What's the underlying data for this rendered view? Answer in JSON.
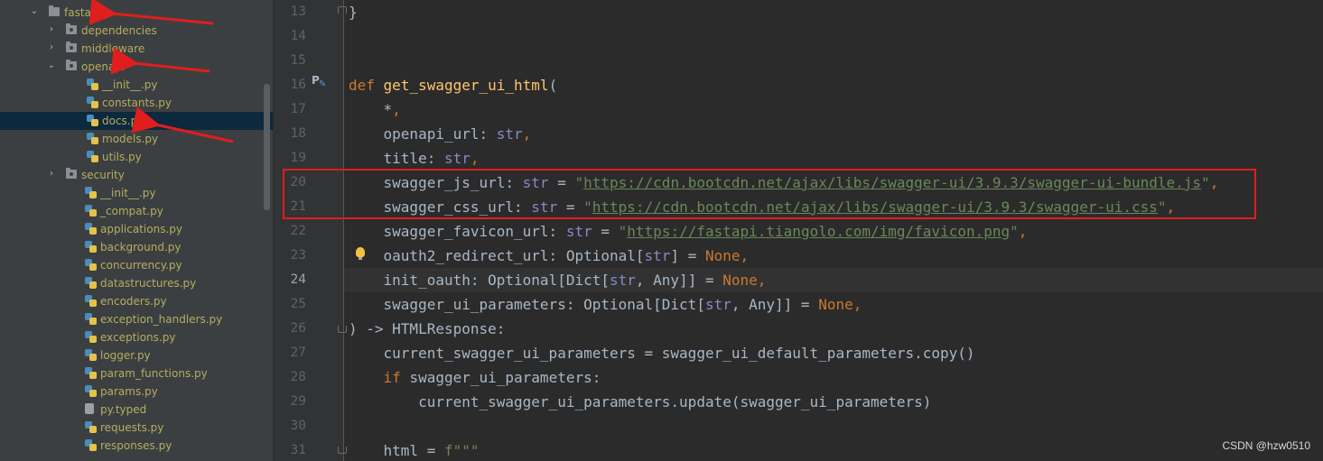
{
  "project_tree": {
    "items": [
      {
        "label": "fastapi",
        "kind": "folder",
        "depth": 0,
        "arrow": "open",
        "selected": false
      },
      {
        "label": "dependencies",
        "kind": "package",
        "depth": 1,
        "arrow": "closed",
        "selected": false
      },
      {
        "label": "middleware",
        "kind": "package",
        "depth": 1,
        "arrow": "closed",
        "selected": false
      },
      {
        "label": "openapi",
        "kind": "package",
        "depth": 1,
        "arrow": "open",
        "selected": false
      },
      {
        "label": "__init__.py",
        "kind": "py",
        "depth": 2,
        "arrow": "none",
        "selected": false
      },
      {
        "label": "constants.py",
        "kind": "py",
        "depth": 2,
        "arrow": "none",
        "selected": false
      },
      {
        "label": "docs.py",
        "kind": "py",
        "depth": 2,
        "arrow": "none",
        "selected": true
      },
      {
        "label": "models.py",
        "kind": "py",
        "depth": 2,
        "arrow": "none",
        "selected": false
      },
      {
        "label": "utils.py",
        "kind": "py",
        "depth": 2,
        "arrow": "none",
        "selected": false
      },
      {
        "label": "security",
        "kind": "package",
        "depth": 1,
        "arrow": "closed",
        "selected": false
      },
      {
        "label": "__init__.py",
        "kind": "py",
        "depth": 1,
        "arrow": "none",
        "selected": false
      },
      {
        "label": "_compat.py",
        "kind": "py",
        "depth": 1,
        "arrow": "none",
        "selected": false
      },
      {
        "label": "applications.py",
        "kind": "py",
        "depth": 1,
        "arrow": "none",
        "selected": false
      },
      {
        "label": "background.py",
        "kind": "py",
        "depth": 1,
        "arrow": "none",
        "selected": false
      },
      {
        "label": "concurrency.py",
        "kind": "py",
        "depth": 1,
        "arrow": "none",
        "selected": false
      },
      {
        "label": "datastructures.py",
        "kind": "py",
        "depth": 1,
        "arrow": "none",
        "selected": false
      },
      {
        "label": "encoders.py",
        "kind": "py",
        "depth": 1,
        "arrow": "none",
        "selected": false
      },
      {
        "label": "exception_handlers.py",
        "kind": "py",
        "depth": 1,
        "arrow": "none",
        "selected": false
      },
      {
        "label": "exceptions.py",
        "kind": "py",
        "depth": 1,
        "arrow": "none",
        "selected": false
      },
      {
        "label": "logger.py",
        "kind": "py",
        "depth": 1,
        "arrow": "none",
        "selected": false
      },
      {
        "label": "param_functions.py",
        "kind": "py",
        "depth": 1,
        "arrow": "none",
        "selected": false
      },
      {
        "label": "params.py",
        "kind": "py",
        "depth": 1,
        "arrow": "none",
        "selected": false
      },
      {
        "label": "py.typed",
        "kind": "file",
        "depth": 1,
        "arrow": "none",
        "selected": false
      },
      {
        "label": "requests.py",
        "kind": "py",
        "depth": 1,
        "arrow": "none",
        "selected": false
      },
      {
        "label": "responses.py",
        "kind": "py",
        "depth": 1,
        "arrow": "none",
        "selected": false
      }
    ]
  },
  "editor": {
    "current_line": "24",
    "lines": [
      {
        "n": "13",
        "tokens": [
          [
            "p",
            "}"
          ]
        ]
      },
      {
        "n": "14",
        "tokens": []
      },
      {
        "n": "15",
        "tokens": []
      },
      {
        "n": "16",
        "tokens": [
          [
            "kw",
            "def "
          ],
          [
            "fn",
            "get_swagger_ui_html"
          ],
          [
            "p",
            "("
          ]
        ]
      },
      {
        "n": "17",
        "tokens": [
          [
            "p",
            "    *"
          ],
          [
            "pun",
            ","
          ]
        ]
      },
      {
        "n": "18",
        "tokens": [
          [
            "p",
            "    openapi_url: "
          ],
          [
            "bi",
            "str"
          ],
          [
            "pun",
            ","
          ]
        ]
      },
      {
        "n": "19",
        "tokens": [
          [
            "p",
            "    title: "
          ],
          [
            "bi",
            "str"
          ],
          [
            "pun",
            ","
          ]
        ]
      },
      {
        "n": "20",
        "tokens": [
          [
            "p",
            "    swagger_js_url: "
          ],
          [
            "bi",
            "str"
          ],
          [
            "p",
            " = "
          ],
          [
            "str",
            "\""
          ],
          [
            "url",
            "https://cdn.bootcdn.net/ajax/libs/swagger-ui/3.9.3/swagger-ui-bundle.js"
          ],
          [
            "str",
            "\""
          ],
          [
            "pun",
            ","
          ]
        ]
      },
      {
        "n": "21",
        "tokens": [
          [
            "p",
            "    swagger_css_url: "
          ],
          [
            "bi",
            "str"
          ],
          [
            "p",
            " = "
          ],
          [
            "str",
            "\""
          ],
          [
            "url",
            "https://cdn.bootcdn.net/ajax/libs/swagger-ui/3.9.3/swagger-ui.css"
          ],
          [
            "str",
            "\""
          ],
          [
            "pun",
            ","
          ]
        ]
      },
      {
        "n": "22",
        "tokens": [
          [
            "p",
            "    swagger_favicon_url: "
          ],
          [
            "bi",
            "str"
          ],
          [
            "p",
            " = "
          ],
          [
            "str",
            "\""
          ],
          [
            "url",
            "https://fastapi.tiangolo.com/img/favicon.png"
          ],
          [
            "str",
            "\""
          ],
          [
            "pun",
            ","
          ]
        ]
      },
      {
        "n": "23",
        "tokens": [
          [
            "p",
            "    oauth2_redirect_url: Optional["
          ],
          [
            "bi",
            "str"
          ],
          [
            "p",
            "] = "
          ],
          [
            "kw",
            "None"
          ],
          [
            "pun",
            ","
          ]
        ]
      },
      {
        "n": "24",
        "tokens": [
          [
            "p",
            "    init_oauth: Optional[Dict["
          ],
          [
            "bi",
            "str"
          ],
          [
            "p",
            ", Any]] = "
          ],
          [
            "kw",
            "None"
          ],
          [
            "pun",
            ","
          ]
        ]
      },
      {
        "n": "25",
        "tokens": [
          [
            "p",
            "    swagger_ui_parameters: Optional[Dict["
          ],
          [
            "bi",
            "str"
          ],
          [
            "p",
            ", Any]] = "
          ],
          [
            "kw",
            "None"
          ],
          [
            "pun",
            ","
          ]
        ]
      },
      {
        "n": "26",
        "tokens": [
          [
            "p",
            ") -> HTMLResponse:"
          ]
        ]
      },
      {
        "n": "27",
        "tokens": [
          [
            "p",
            "    current_swagger_ui_parameters = swagger_ui_default_parameters.copy()"
          ]
        ]
      },
      {
        "n": "28",
        "tokens": [
          [
            "p",
            "    "
          ],
          [
            "kw",
            "if "
          ],
          [
            "p",
            "swagger_ui_parameters:"
          ]
        ]
      },
      {
        "n": "29",
        "tokens": [
          [
            "p",
            "        current_swagger_ui_parameters.update(swagger_ui_parameters)"
          ]
        ]
      },
      {
        "n": "30",
        "tokens": []
      },
      {
        "n": "31",
        "tokens": [
          [
            "p",
            "    html = "
          ],
          [
            "str",
            "f\"\"\""
          ]
        ]
      }
    ]
  },
  "watermark": "CSDN @hzw0510",
  "colors": {
    "annotation_red": "#e01e1e",
    "highlight_box": "#e01e1e"
  }
}
